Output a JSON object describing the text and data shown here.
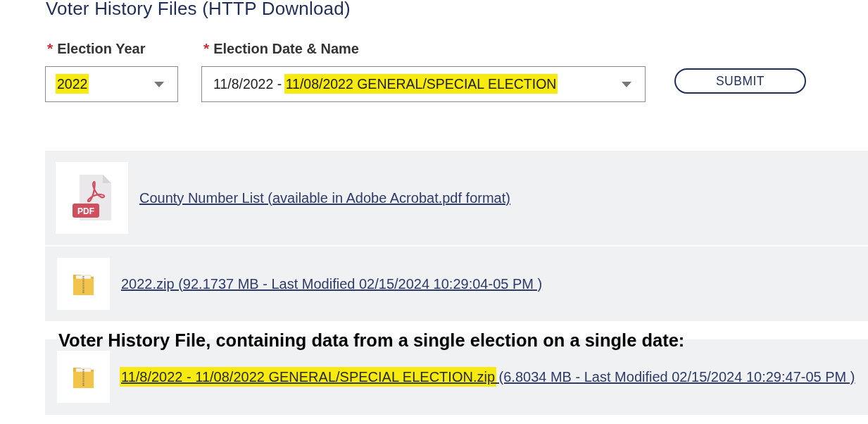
{
  "page": {
    "title": "Voter History Files (HTTP Download)"
  },
  "form": {
    "fields": [
      {
        "required_mark": "*",
        "label": "Election Year",
        "value_parts": [
          {
            "text": "2022",
            "highlighted": true
          }
        ]
      },
      {
        "required_mark": "*",
        "label": "Election Date & Name",
        "value_parts": [
          {
            "text": "11/8/2022 - ",
            "highlighted": false
          },
          {
            "text": "11/08/2022 GENERAL/SPECIAL ELECTION",
            "highlighted": true
          }
        ]
      }
    ],
    "submit": {
      "label": "SUBMIT"
    }
  },
  "downloads": [
    {
      "kind": "pdf",
      "icon_label": "PDF",
      "link_parts": [
        {
          "text": "County Number List (available in Adobe Acrobat.pdf format)",
          "highlighted": false
        }
      ]
    },
    {
      "kind": "zip",
      "link_parts": [
        {
          "text": "2022.zip (92.1737 MB - Last Modified 02/15/2024 10:29:04-05 PM )",
          "highlighted": false
        }
      ]
    },
    {
      "kind": "zip",
      "caption": "Voter History File, containing data from a single election on a single date:",
      "link_parts": [
        {
          "text": "11/8/2022 - 11/08/2022 GENERAL/SPECIAL ELECTION.zip",
          "highlighted": true
        },
        {
          "text": " (6.8034 MB - Last Modified 02/15/2024 10:29:47-05 PM )",
          "highlighted": false
        }
      ]
    }
  ]
}
